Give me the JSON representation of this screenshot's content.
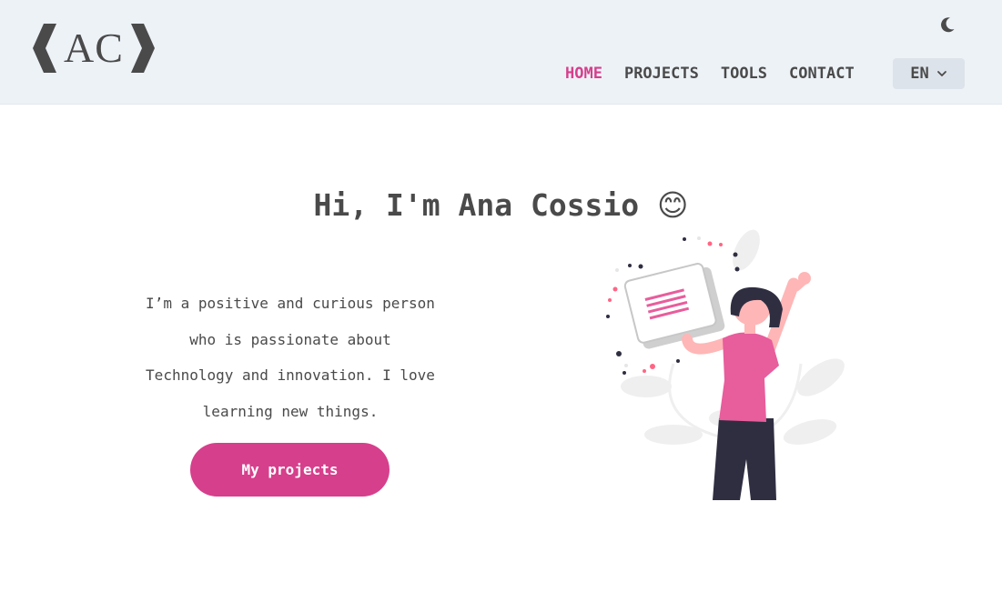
{
  "header": {
    "logo": {
      "letters": "AC"
    },
    "theme_toggle": {
      "icon": "moon-icon"
    },
    "nav": [
      {
        "label": "HOME",
        "active": true
      },
      {
        "label": "PROJECTS",
        "active": false
      },
      {
        "label": "TOOLS",
        "active": false
      },
      {
        "label": "CONTACT",
        "active": false
      }
    ],
    "language": {
      "value": "EN",
      "icon": "chevron-down-icon"
    }
  },
  "hero": {
    "title": "Hi, I'm Ana Cossio",
    "title_emoji": "😊",
    "intro": "I’m a positive and curious person who is passionate about Technology and innovation. I love learning new things.",
    "cta_label": "My projects"
  },
  "colors": {
    "accent": "#d63f8c",
    "header_bg": "#edf2f7",
    "text": "#4a4a4a",
    "dark": "#2f2e41",
    "skin": "#ffb6b6"
  }
}
